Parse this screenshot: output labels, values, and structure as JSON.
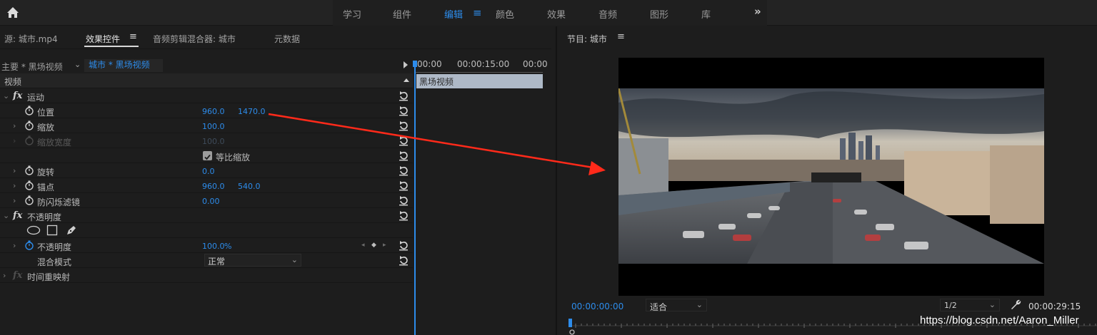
{
  "workspace": {
    "tabs": [
      "学习",
      "组件",
      "编辑",
      "颜色",
      "效果",
      "音频",
      "图形",
      "库"
    ],
    "active_tab": "编辑",
    "more": "»"
  },
  "left_panel": {
    "tabs": [
      "源: 城市.mp4",
      "效果控件",
      "音频剪辑混合器: 城市",
      "元数据"
    ],
    "active_tab": "效果控件",
    "menu_glyph": "≡",
    "source_main": "主要 * 黑场视频",
    "source_clip": "城市 * 黑场视频",
    "video_header": "视频",
    "motion": {
      "label": "运动",
      "position": {
        "label": "位置",
        "x": "960.0",
        "y": "1470.0"
      },
      "scale": {
        "label": "缩放",
        "value": "100.0"
      },
      "scale_width": {
        "label": "缩放宽度",
        "value": "100.0"
      },
      "uniform_scale": {
        "label": "等比缩放",
        "checked": true
      },
      "rotation": {
        "label": "旋转",
        "value": "0.0"
      },
      "anchor": {
        "label": "锚点",
        "x": "960.0",
        "y": "540.0"
      },
      "anti_flicker": {
        "label": "防闪烁滤镜",
        "value": "0.00"
      }
    },
    "opacity": {
      "label": "不透明度",
      "value_label": "不透明度",
      "value": "100.0",
      "unit": "%",
      "blend_label": "混合模式",
      "blend_value": "正常"
    },
    "time_remap": {
      "label": "时间重映射"
    }
  },
  "timeline": {
    "times": [
      "00:00",
      "00:00:15:00",
      "00:00"
    ],
    "clip_label": "黑场视频"
  },
  "program": {
    "title": "节目: 城市",
    "menu_glyph": "≡",
    "timecode_current": "00:00:00:00",
    "fit": "适合",
    "resolution": "1/2",
    "timecode_duration": "00:00:29:15"
  },
  "watermark": "https://blog.csdn.net/Aaron_Miller",
  "colors": {
    "accent": "#2d8ceb",
    "arrow": "#ff2a1a"
  }
}
